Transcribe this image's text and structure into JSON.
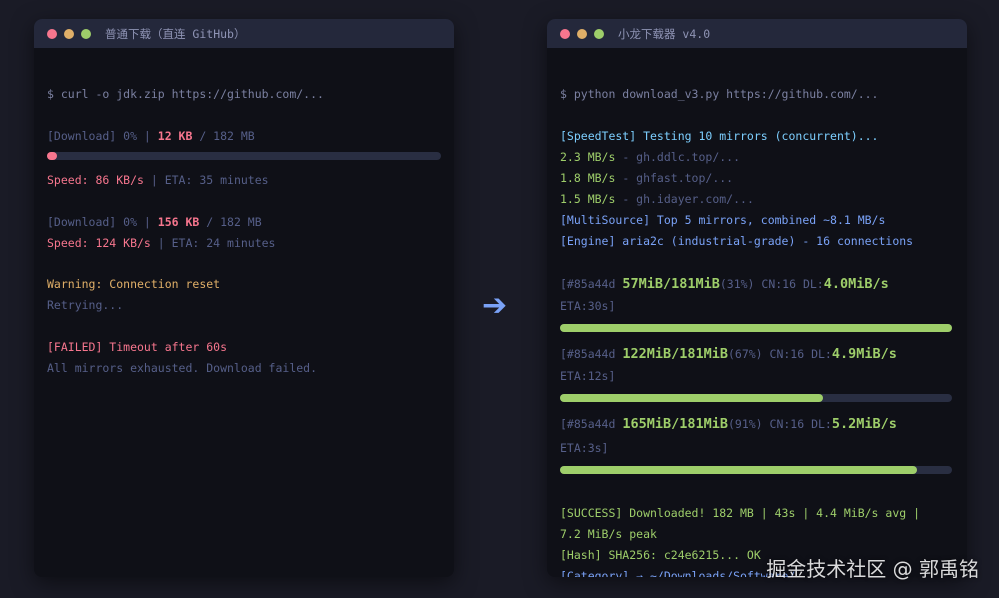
{
  "left": {
    "title": "普通下载（直连 GitHub）",
    "cmd": "$ curl -o jdk.zip https://github.com/...",
    "dl1_prefix": "[Download] 0% | ",
    "dl1_amount": "12 KB",
    "dl1_total": " / 182 MB",
    "dl1_progress": 0.02,
    "speed1": "Speed: 86 KB/s",
    "eta1": " | ETA: 35 minutes",
    "dl2_prefix": "[Download] 0% | ",
    "dl2_amount": "156 KB",
    "dl2_total": " / 182 MB",
    "speed2": "Speed: 124 KB/s",
    "eta2": " | ETA: 24 minutes",
    "warning": "Warning: Connection reset",
    "retrying": "Retrying...",
    "failed": "[FAILED] Timeout after 60s",
    "exhausted": "All mirrors exhausted. Download failed."
  },
  "arrow": "➔",
  "right": {
    "title": "小龙下载器 v4.0",
    "cmd": "$ python download_v3.py https://github.com/...",
    "speedtest": "[SpeedTest] Testing 10 mirrors (concurrent)...",
    "m1_speed": "2.3 MB/s",
    "m1_host": " - gh.ddlc.top/...",
    "m2_speed": "1.8 MB/s",
    "m2_host": " - ghfast.top/...",
    "m3_speed": "1.5 MB/s",
    "m3_host": " - gh.idayer.com/...",
    "multisource": "[MultiSource] Top 5 mirrors, combined ~8.1 MB/s",
    "engine": "[Engine] aria2c (industrial-grade) - 16 connections",
    "p1_id": "[#85a44d ",
    "p1_size": "57MiB/181MiB",
    "p1_pct": "(31%) CN:16 DL:",
    "p1_speed": "4.0MiB/s",
    "p1_eta": "ETA:30s]",
    "p1_progress": 1.0,
    "p2_id": "[#85a44d ",
    "p2_size": "122MiB/181MiB",
    "p2_pct": "(67%) CN:16 DL:",
    "p2_speed": "4.9MiB/s",
    "p2_eta": "ETA:12s]",
    "p2_progress": 0.67,
    "p3_id": "[#85a44d ",
    "p3_size": "165MiB/181MiB",
    "p3_pct": "(91%) CN:16 DL:",
    "p3_speed": "5.2MiB/s",
    "p3_eta": "ETA:3s]",
    "p3_progress": 0.91,
    "success1": "[SUCCESS] Downloaded! 182 MB | 43s | 4.4 MiB/s avg |",
    "success2": "7.2 MiB/s peak",
    "hash": "[Hash] SHA256: c24e6215... OK",
    "category": "[Category] → ~/Downloads/Software/"
  },
  "watermark": "掘金技术社区 @ 郭禹铭",
  "colors": {
    "bg": "#1a1b26",
    "terminal": "#0f1017",
    "red": "#f7768e",
    "green": "#9ece6a",
    "blue": "#7aa2f7",
    "orange": "#e0af68"
  }
}
